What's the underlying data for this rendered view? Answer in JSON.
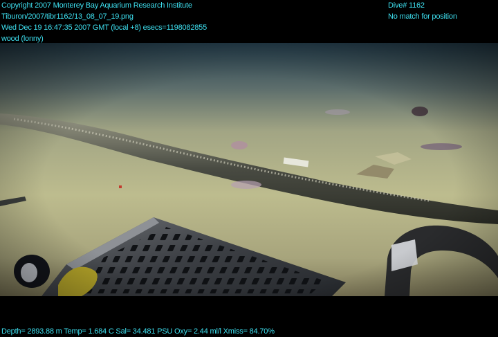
{
  "header_left": {
    "copyright": "Copyright 2007 Monterey Bay Aquarium Research Institute",
    "file_path": "Tiburon/2007/tibr1162/13_08_07_19.png",
    "timestamp": "Wed Dec 19 16:47:35 2007 GMT (local +8)  esecs=1198082855",
    "annotation": "wood (lonny)"
  },
  "header_right": {
    "dive": "Dive# 1162",
    "position_status": "No match for position"
  },
  "footer": {
    "telemetry": "Depth= 2893.88 m  Temp= 1.684 C  Sal= 34.481 PSU  Oxy= 2.44 ml/l  Xmiss= 84.70%"
  },
  "colors": {
    "overlay_text": "#3ee0f0",
    "seafloor": "#b9b98a",
    "water": "#2f4a5e"
  }
}
